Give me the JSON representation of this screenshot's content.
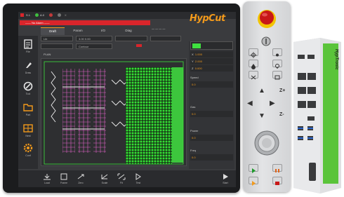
{
  "brand": {
    "logo": "HypCut"
  },
  "status": {
    "items": [
      "S.1",
      "A.0",
      "E0",
      "X"
    ]
  },
  "alarm": {
    "text": "—— No Alarm ——",
    "right": "— — — —"
  },
  "tabs": [
    {
      "label": "Draft",
      "active": true
    },
    {
      "label": "Param"
    },
    {
      "label": "I/O"
    },
    {
      "label": "Diag"
    }
  ],
  "sidebar": [
    {
      "label": "File",
      "icon": "file-icon"
    },
    {
      "label": "Draw",
      "icon": "draw-icon"
    },
    {
      "label": "Tool",
      "icon": "tool-icon"
    },
    {
      "label": "Part",
      "icon": "part-icon"
    },
    {
      "label": "Nest",
      "icon": "nest-icon"
    },
    {
      "label": "Conf",
      "icon": "gear-icon"
    }
  ],
  "fields": {
    "row1": [
      "Lib",
      "3.00 0.00",
      "",
      ""
    ],
    "row2": [
      "",
      "Contour",
      "",
      ""
    ]
  },
  "plot": {
    "label": "PLAN"
  },
  "right_panel": {
    "coords": [
      {
        "axis": "X",
        "value": "1.000"
      },
      {
        "axis": "Y",
        "value": "2.000"
      },
      {
        "axis": "Z",
        "value": "0.000"
      }
    ],
    "sections": [
      {
        "title": "Speed",
        "value": "0.0"
      },
      {
        "title": "Gas",
        "value": "0.0"
      },
      {
        "title": "Power",
        "value": "0.0"
      },
      {
        "title": "Freq",
        "value": "0.0"
      }
    ]
  },
  "bottom_bar": [
    {
      "label": "Load",
      "icon": "load-icon"
    },
    {
      "label": "Frame",
      "icon": "frame-icon"
    },
    {
      "label": "Zero",
      "icon": "zero-icon"
    },
    {
      "label": "Scale",
      "icon": "scale-icon"
    },
    {
      "label": "Fit",
      "icon": "fit-icon"
    },
    {
      "label": "Test",
      "icon": "test-icon"
    },
    {
      "label": "Start",
      "icon": "start-icon"
    }
  ],
  "pendant": {
    "emergency_stop": "emergency-stop",
    "keys": [
      "Z+",
      "Z-"
    ]
  },
  "ipc": {
    "brand": "HypTronic"
  },
  "colors": {
    "accent": "#f39a1b",
    "alarm": "#d9252b",
    "parts": "#3fe13f",
    "contour": "#e060c8"
  }
}
